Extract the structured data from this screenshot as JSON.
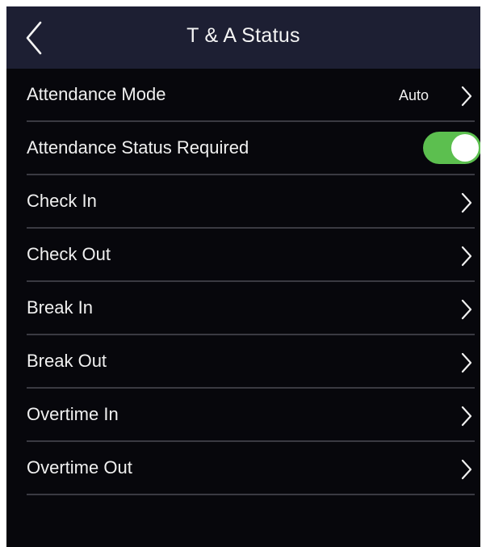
{
  "header": {
    "title": "T & A Status",
    "back_icon": "chevron-left-icon"
  },
  "settings": {
    "attendance_mode": {
      "label": "Attendance Mode",
      "value": "Auto"
    },
    "attendance_status_required": {
      "label": "Attendance Status Required",
      "enabled": true,
      "toggle_color": "#5cbf4f"
    },
    "items": [
      {
        "label": "Check In"
      },
      {
        "label": "Check Out"
      },
      {
        "label": "Break In"
      },
      {
        "label": "Break Out"
      },
      {
        "label": "Overtime In"
      },
      {
        "label": "Overtime Out"
      }
    ]
  },
  "colors": {
    "background": "#07070c",
    "header": "#1d1f33",
    "divider": "#3a3a42",
    "text": "#f0f0f0"
  }
}
